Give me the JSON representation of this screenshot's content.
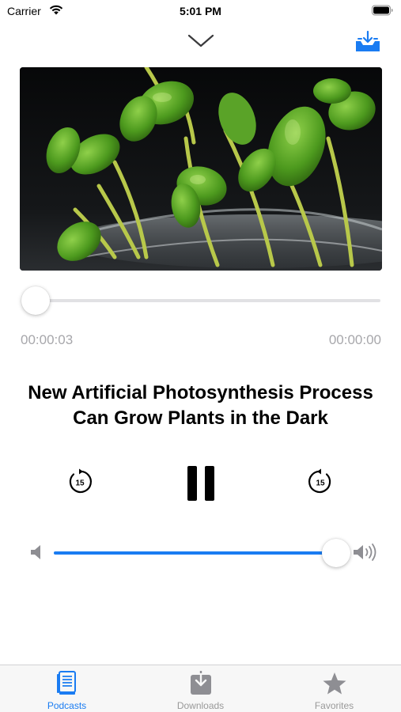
{
  "status_bar": {
    "carrier": "Carrier",
    "time": "5:01 PM"
  },
  "player": {
    "elapsed_time": "00:00:03",
    "total_time": "00:00:00",
    "progress_fraction": 0.009,
    "title": "New Artificial Photosynthesis Process Can Grow Plants in the Dark",
    "skip_back_seconds": "15",
    "skip_forward_seconds": "15",
    "volume_fraction": 0.96,
    "state": "playing"
  },
  "tabs": [
    {
      "label": "Podcasts",
      "icon": "podcasts-document-icon",
      "active": true
    },
    {
      "label": "Downloads",
      "icon": "downloads-tray-icon",
      "active": false
    },
    {
      "label": "Favorites",
      "icon": "star-icon",
      "active": false
    }
  ],
  "colors": {
    "accent": "#1a7cf2",
    "inactive": "#999999",
    "time_text": "#a7a7ab",
    "track": "#e1e1e4"
  }
}
